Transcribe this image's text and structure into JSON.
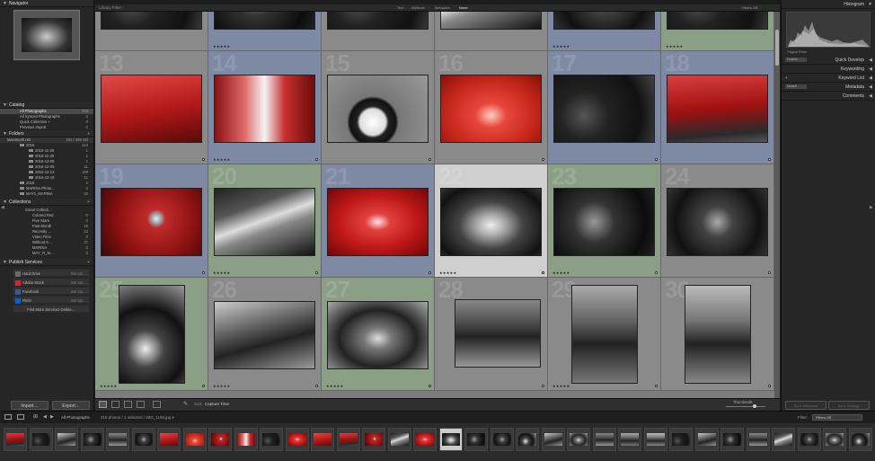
{
  "window": {
    "title": "Library Filter :"
  },
  "library_filter": {
    "items": [
      "Text",
      "Attribute",
      "Metadata",
      "None"
    ],
    "selected": "None",
    "right_label": "Filters Off"
  },
  "left_panel": {
    "navigator": {
      "title": "Navigator",
      "zoom_options": [
        "FIT",
        "FILL",
        "1:1",
        "3:1"
      ]
    },
    "catalog": {
      "title": "Catalog",
      "items": [
        {
          "label": "All Photographs",
          "count": "318"
        },
        {
          "label": "All Synced Photographs",
          "count": "0"
        },
        {
          "label": "Quick Collection +",
          "count": "0"
        },
        {
          "label": "Previous Import",
          "count": "0"
        }
      ]
    },
    "folders": {
      "title": "Folders",
      "volume": "Macintosh HD",
      "volume_info": "192 / 499 GB",
      "items": [
        {
          "label": "2016",
          "count": "224"
        },
        {
          "label": "2016-11-28",
          "count": "1"
        },
        {
          "label": "2016-11-30",
          "count": "1"
        },
        {
          "label": "2016-12-08",
          "count": "1"
        },
        {
          "label": "2016-12-09",
          "count": "11"
        },
        {
          "label": "2016-12-13",
          "count": "199"
        },
        {
          "label": "2016-12-19",
          "count": "11"
        },
        {
          "label": "2016",
          "count": "2"
        },
        {
          "label": "MARINA Photo…",
          "count": "0"
        },
        {
          "label": "MAY1_MARINA",
          "count": "92"
        }
      ]
    },
    "collections": {
      "title": "Collections",
      "items": [
        {
          "label": "Smart Collecti…",
          "count": ""
        },
        {
          "label": "Colored Red",
          "count": "0"
        },
        {
          "label": "Five Stars",
          "count": "0"
        },
        {
          "label": "Past Month",
          "count": "19"
        },
        {
          "label": "Recently …",
          "count": "22"
        },
        {
          "label": "Video Files",
          "count": "0"
        },
        {
          "label": "Without K…",
          "count": "37"
        },
        {
          "label": "MARINA",
          "count": "0"
        },
        {
          "label": "MAY_R_M…",
          "count": "0"
        }
      ]
    },
    "publish": {
      "title": "Publish Services",
      "items": [
        {
          "label": "Hard Drive",
          "action": "Set Up…",
          "color": "#6a6a6a"
        },
        {
          "label": "Adobe Stock",
          "action": "Set Up…",
          "color": "#d4262a"
        },
        {
          "label": "Facebook",
          "action": "Set Up…",
          "color": "#3b5998"
        },
        {
          "label": "Flickr",
          "action": "Set Up…",
          "color": "#0063dc"
        }
      ],
      "find_more": "Find More Services Online…"
    },
    "import_label": "Import…",
    "export_label": "Export…"
  },
  "right_panel": {
    "histogram": {
      "title": "Histogram",
      "info": [
        "ISO 100",
        "18 mm",
        "f / 5.6",
        "1/80 sec"
      ],
      "original_photo": "Original Photo"
    },
    "quick_develop": {
      "title": "Quick Develop",
      "preset": "Custom"
    },
    "keywording": {
      "title": "Keywording"
    },
    "keyword_list": {
      "title": "Keyword List"
    },
    "metadata": {
      "title": "Metadata",
      "preset": "Default"
    },
    "comments": {
      "title": "Comments"
    },
    "sync_metadata": "Sync Metadata",
    "sync_settings": "Sync Settings"
  },
  "toolbar": {
    "sort_label": "Sort:",
    "sort_value": "Capture Time",
    "thumbnails_label": "Thumbnails"
  },
  "filmstrip_bar": {
    "source": "All Photographs",
    "info": "318 photos / 1 selected / IMG_1155.jpg ▾",
    "filter_label": "Filter:",
    "filter_value": "Filters Off"
  },
  "grid": {
    "cells": [
      {
        "num": "13",
        "bg": "gray",
        "stars": "",
        "img": "red-trunk"
      },
      {
        "num": "14",
        "bg": "blue",
        "stars": "★★★★★",
        "img": "red-chrome"
      },
      {
        "num": "15",
        "bg": "gray",
        "stars": "",
        "img": "gray-wheel"
      },
      {
        "num": "16",
        "bg": "gray",
        "stars": "",
        "img": "red-ornament"
      },
      {
        "num": "17",
        "bg": "blue",
        "stars": "",
        "img": "dark-engine"
      },
      {
        "num": "18",
        "bg": "blue",
        "stars": "",
        "img": "red-car"
      },
      {
        "num": "19",
        "bg": "blue",
        "stars": "",
        "img": "red-emblem"
      },
      {
        "num": "20",
        "bg": "green",
        "stars": "★★★★★",
        "img": "gray-window"
      },
      {
        "num": "21",
        "bg": "blue",
        "stars": "",
        "img": "red-ornament2"
      },
      {
        "num": "22",
        "bg": "sel",
        "stars": "★★★★★",
        "img": "engine"
      },
      {
        "num": "23",
        "bg": "green",
        "stars": "★★★★★",
        "img": "dark-engine2"
      },
      {
        "num": "24",
        "bg": "gray",
        "stars": "",
        "img": "dark-engine3"
      },
      {
        "num": "25",
        "bg": "green",
        "stars": "★★★★★",
        "img": "bw-bike"
      },
      {
        "num": "26",
        "bg": "gray",
        "stars": "★★★★★",
        "img": "bw-body"
      },
      {
        "num": "27",
        "bg": "green",
        "stars": "★★★★★",
        "img": "bw-engine"
      },
      {
        "num": "28",
        "bg": "gray",
        "stars": "",
        "img": "bw-hotrod"
      },
      {
        "num": "29",
        "bg": "gray",
        "stars": "★★★★★",
        "img": "bw-hotrod2"
      },
      {
        "num": "30",
        "bg": "gray",
        "stars": "",
        "img": "bw-hotrod3"
      }
    ],
    "top_row_stars": [
      "",
      "★★★★★",
      "",
      "",
      "★★★★★",
      "★★★★★"
    ]
  }
}
